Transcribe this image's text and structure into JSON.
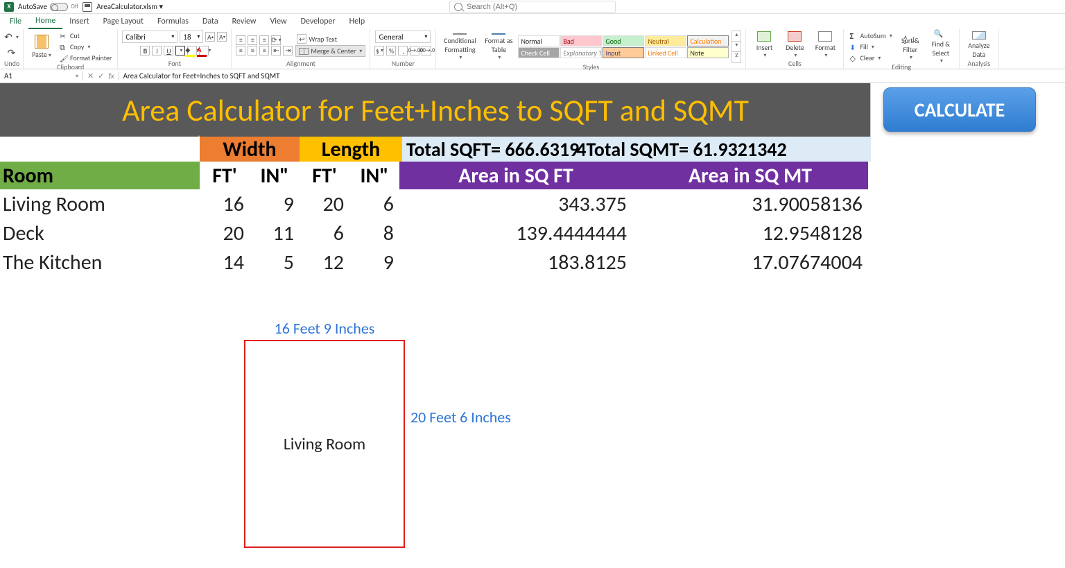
{
  "titlebar": {
    "autosave_label": "AutoSave",
    "autosave_state": "Off",
    "filename": "AreaCalculator.xlsm ▾",
    "search_placeholder": "Search (Alt+Q)"
  },
  "menubar": {
    "tabs": [
      "File",
      "Home",
      "Insert",
      "Page Layout",
      "Formulas",
      "Data",
      "Review",
      "View",
      "Developer",
      "Help"
    ],
    "active": "Home"
  },
  "ribbon": {
    "undo_group": "Undo",
    "clipboard": {
      "paste": "Paste",
      "cut": "Cut",
      "copy": "Copy",
      "painter": "Format Painter",
      "label": "Clipboard"
    },
    "font": {
      "name": "Calibri",
      "size": "18",
      "label": "Font"
    },
    "alignment": {
      "wrap": "Wrap Text",
      "merge": "Merge & Center",
      "label": "Alignment"
    },
    "number": {
      "format": "General",
      "label": "Number"
    },
    "styles": {
      "cond": "Conditional Formatting",
      "cond1": "Conditional",
      "cond2": "Formatting",
      "fat": "Format as Table",
      "fat1": "Format as",
      "fat2": "Table",
      "cells": [
        "Normal",
        "Bad",
        "Good",
        "Neutral",
        "Calculation",
        "Check Cell",
        "Explanatory T...",
        "Input",
        "Linked Cell",
        "Note"
      ],
      "label": "Styles"
    },
    "cells_group": {
      "insert": "Insert",
      "delete": "Delete",
      "format": "Format",
      "label": "Cells"
    },
    "editing": {
      "autosum": "AutoSum",
      "fill": "Fill",
      "clear": "Clear",
      "sort": "Sort & Filter",
      "find": "Find & Select",
      "sort1": "Sort &",
      "sort2": "Filter",
      "find1": "Find &",
      "find2": "Select",
      "label": "Editing"
    },
    "analysis": {
      "analyze": "Analyze Data",
      "analyze1": "Analyze",
      "analyze2": "Data",
      "label": "Analysis"
    }
  },
  "formula_bar": {
    "name_box": "A1",
    "fx_label": "fx",
    "content": "Area Calculator for Feet+Inches to SQFT and SQMT"
  },
  "sheet": {
    "title": "Area Calculator for Feet+Inches to SQFT and SQMT",
    "calc_button": "CALCULATE",
    "headers": {
      "width": "Width",
      "length": "Length",
      "total_sqft_label": "Total SQFT=",
      "total_sqft_value": "666.6319",
      "total_sqmt_label": "Total SQMT=",
      "total_sqmt_value": "61.9321342",
      "room": "Room",
      "ft": "FT'",
      "in": "IN\"",
      "area_sqft": "Area in SQ FT",
      "area_sqmt": "Area in SQ MT"
    },
    "rows": [
      {
        "room": "Living Room",
        "wft": "16",
        "win": "9",
        "lft": "20",
        "lin": "6",
        "sqft": "343.375",
        "sqmt": "31.90058136"
      },
      {
        "room": "Deck",
        "wft": "20",
        "win": "11",
        "lft": "6",
        "lin": "8",
        "sqft": "139.4444444",
        "sqmt": "12.9548128"
      },
      {
        "room": "The Kitchen",
        "wft": "14",
        "win": "5",
        "lft": "12",
        "lin": "9",
        "sqft": "183.8125",
        "sqmt": "17.07674004"
      }
    ],
    "diagram": {
      "top_dim": "16 Feet 9 Inches",
      "side_dim": "20 Feet 6 Inches",
      "label": "Living Room"
    }
  }
}
